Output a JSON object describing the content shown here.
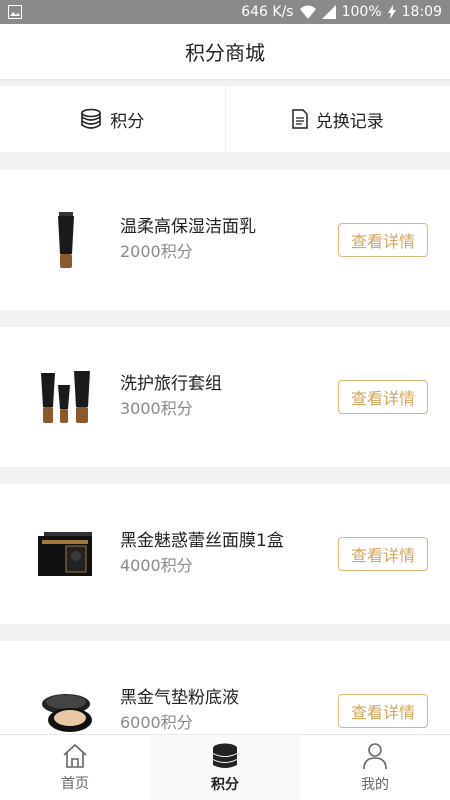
{
  "status": {
    "speed": "646 K/s",
    "battery": "100%",
    "time": "18:09"
  },
  "header": {
    "title": "积分商城"
  },
  "tabs": [
    {
      "label": "积分",
      "icon": "coins-stack-icon"
    },
    {
      "label": "兑换记录",
      "icon": "document-icon"
    }
  ],
  "products": [
    {
      "name": "温柔高保湿洁面乳",
      "points": "2000积分",
      "button": "查看详情",
      "image": "cleanser-tube"
    },
    {
      "name": "洗护旅行套组",
      "points": "3000积分",
      "button": "查看详情",
      "image": "travel-tubes-set"
    },
    {
      "name": "黑金魅惑蕾丝面膜1盒",
      "points": "4000积分",
      "button": "查看详情",
      "image": "face-mask-box"
    },
    {
      "name": "黑金气垫粉底液",
      "points": "6000积分",
      "button": "查看详情",
      "image": "cushion-compact"
    }
  ],
  "nav": [
    {
      "label": "首页",
      "icon": "home-icon",
      "active": false
    },
    {
      "label": "积分",
      "icon": "coins-stack-icon",
      "active": true
    },
    {
      "label": "我的",
      "icon": "user-icon",
      "active": false
    }
  ],
  "colors": {
    "accent_gold": "#d4a55a",
    "button_border": "#d9b878"
  }
}
